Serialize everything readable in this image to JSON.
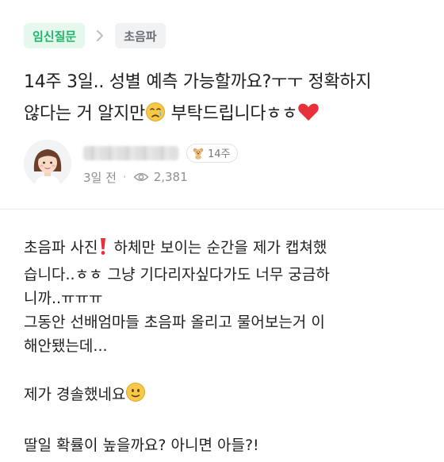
{
  "breadcrumb": {
    "category": "임신질문",
    "subcategory": "초음파"
  },
  "post": {
    "title_line1": "14주 3일.. 성별 예측 가능할까요?ㅜㅜ 정확하지",
    "title_line2_a": "않다는 거 알지만",
    "title_line2_b": " 부탁드립니다ㅎㅎ"
  },
  "author": {
    "week_badge": "14주",
    "time_ago": "3일 전",
    "views": "2,381"
  },
  "content": {
    "l1_a": "초음파 사진",
    "l1_b": " 하체만 보이는 순간을 제가 캡쳐했",
    "l2": "습니다..ㅎㅎ 그냥 기다리자싶다가도 너무 궁금하",
    "l3": "니까..ㅠㅠㅠ",
    "l4": "그동안 선배엄마들 초음파 올리고 물어보는거 이",
    "l5": "해안됐는데...",
    "l6": "제가 경솔했네요",
    "l7": "딸일 확률이 높을까요? 아니면 아들?!"
  },
  "colors": {
    "accent_green": "#1cb468",
    "category_bg": "#e6f8ee",
    "heart_red": "#e8303a"
  }
}
